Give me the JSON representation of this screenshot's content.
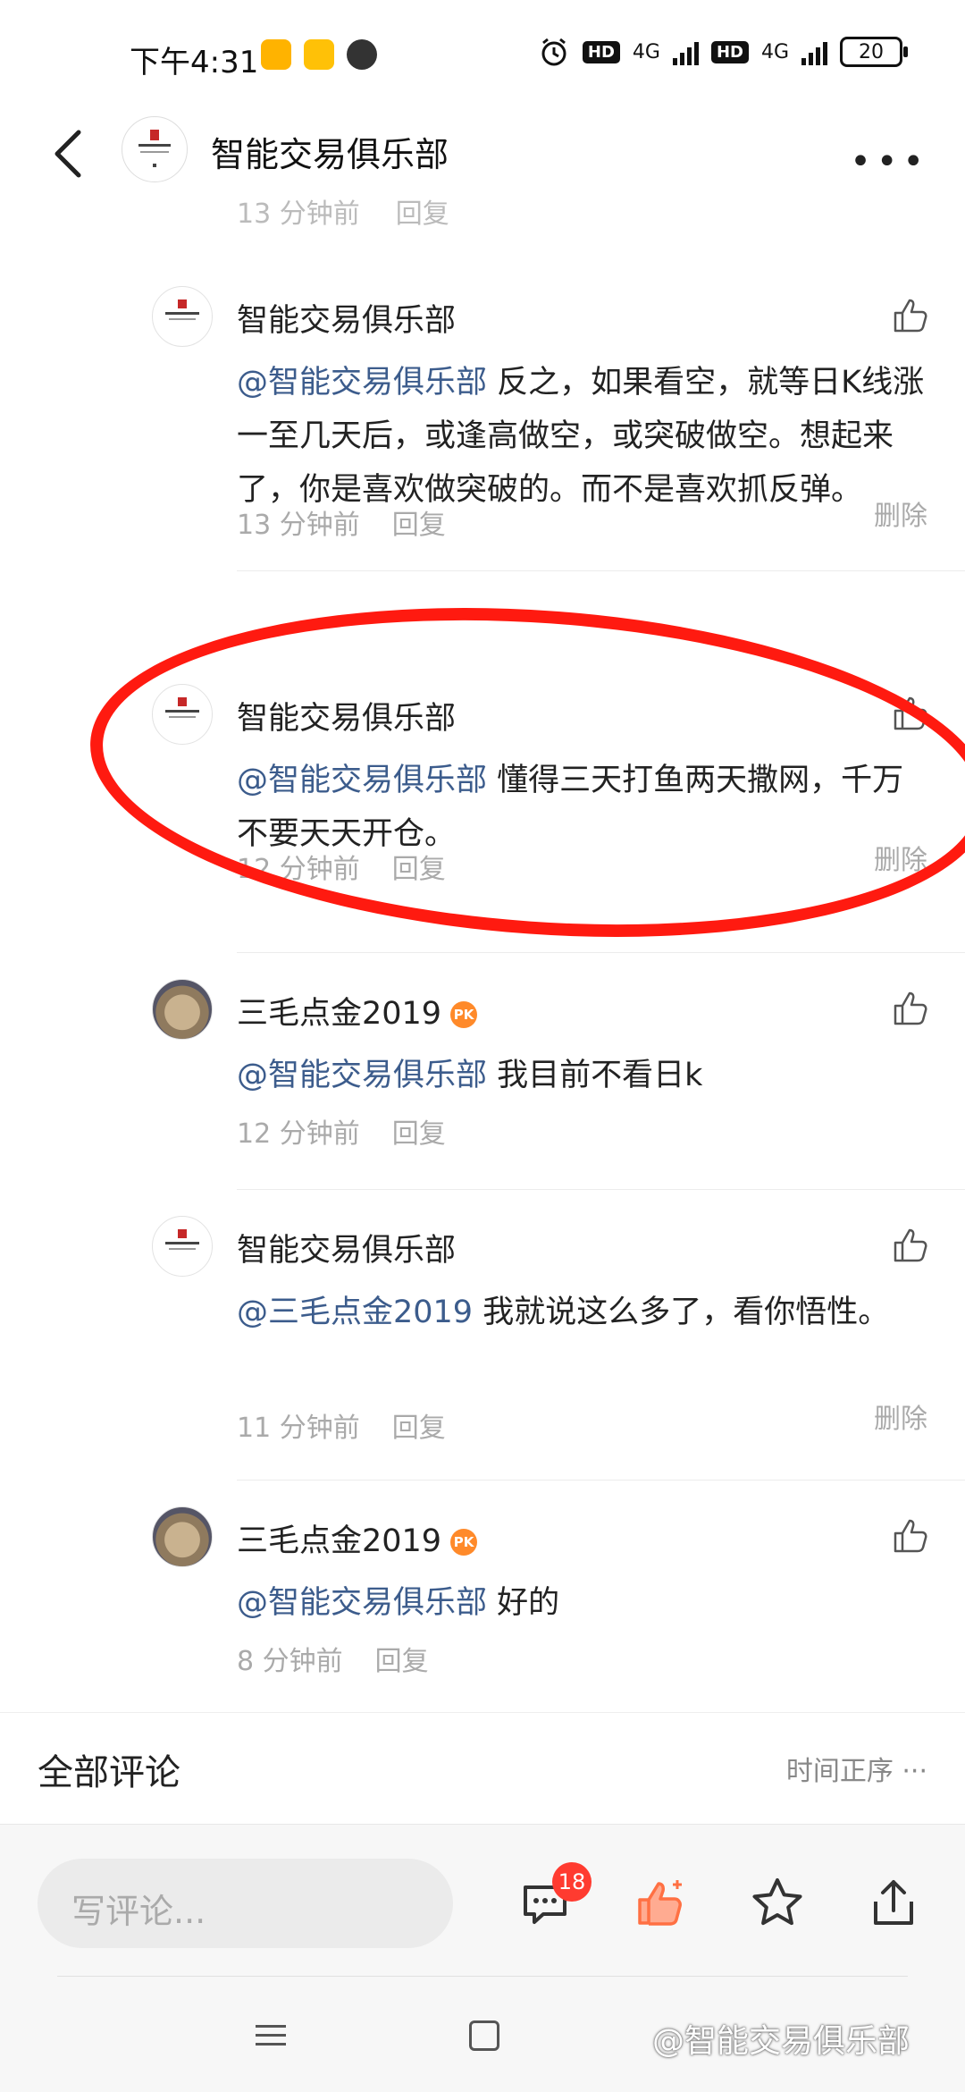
{
  "status": {
    "time": "下午4:31",
    "hd": "HD",
    "network": "4G",
    "battery": "20"
  },
  "header": {
    "title": "智能交易俱乐部"
  },
  "cutoff": {
    "time": "13 分钟前",
    "reply": "回复"
  },
  "comments": [
    {
      "name": "智能交易俱乐部",
      "mention": "@智能交易俱乐部",
      "text": " 反之，如果看空，就等日K线涨一至几天后，或逢高做空，或突破做空。想起来了，你是喜欢做突破的。而不是喜欢抓反弹。",
      "time": "13 分钟前",
      "reply": "回复",
      "delete": "删除"
    },
    {
      "name": "智能交易俱乐部",
      "mention": "@智能交易俱乐部",
      "text": " 懂得三天打鱼两天撒网，千万不要天天开仓。",
      "time": "12 分钟前",
      "reply": "回复",
      "delete": "删除"
    },
    {
      "name": "三毛点金2019",
      "pk": "PK",
      "mention": "@智能交易俱乐部",
      "text": " 我目前不看日k",
      "time": "12 分钟前",
      "reply": "回复"
    },
    {
      "name": "智能交易俱乐部",
      "mention": "@三毛点金2019",
      "text": " 我就说这么多了，看你悟性。",
      "time": "11 分钟前",
      "reply": "回复",
      "delete": "删除"
    },
    {
      "name": "三毛点金2019",
      "pk": "PK",
      "mention": "@智能交易俱乐部",
      "text": " 好的",
      "time": "8 分钟前",
      "reply": "回复"
    }
  ],
  "all_comments": {
    "title": "全部评论",
    "sort": "时间正序 ···"
  },
  "bottom": {
    "placeholder": "写评论...",
    "badge": "18"
  },
  "watermark": "@智能交易俱乐部",
  "colors": {
    "mention": "#3c5c8c",
    "annotation": "#ff1a10",
    "like_active": "#ff7043",
    "badge": "#ff3b30"
  }
}
